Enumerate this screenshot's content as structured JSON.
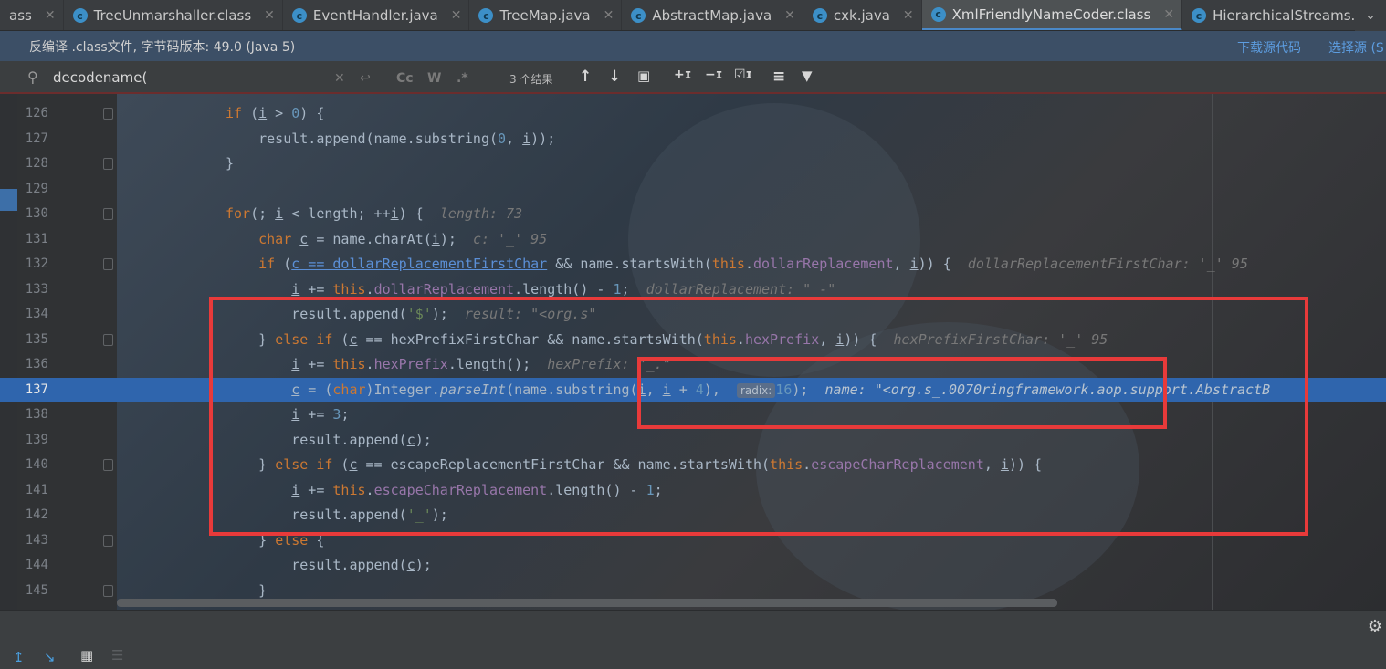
{
  "tabs": [
    {
      "label": "ass",
      "icon": "",
      "active": false
    },
    {
      "label": "TreeUnmarshaller.class",
      "icon": "class-icon",
      "active": false
    },
    {
      "label": "EventHandler.java",
      "icon": "class-icon",
      "active": false
    },
    {
      "label": "TreeMap.java",
      "icon": "class-icon",
      "active": false
    },
    {
      "label": "AbstractMap.java",
      "icon": "class-icon",
      "active": false
    },
    {
      "label": "cxk.java",
      "icon": "class-icon",
      "active": false
    },
    {
      "label": "XmlFriendlyNameCoder.class",
      "icon": "class-icon",
      "active": true
    },
    {
      "label": "HierarchicalStreams.class",
      "icon": "class-icon",
      "active": false
    }
  ],
  "tab_icon_glyph": "c",
  "tab_close": "✕",
  "tab_more": "⌄",
  "infobar": {
    "text": "反编译 .class文件, 字节码版本: 49.0 (Java 5)",
    "download_link": "下载源代码",
    "choose_link": "选择源 (S"
  },
  "find": {
    "query": "decodename(",
    "clear": "✕",
    "replace_icon": "↩",
    "case_label": "Cc",
    "words_label": "W",
    "regex_label": ".*",
    "result_count": "3 个结果",
    "up": "↑",
    "down": "↓",
    "select_all": "▣",
    "add_occ": "+ɪ",
    "remove_occ": "−ɪ",
    "select_occ": "☑ɪ",
    "options": "≡",
    "filter": "▼"
  },
  "code_lines": [
    {
      "num": "126"
    },
    {
      "num": "127"
    },
    {
      "num": "128"
    },
    {
      "num": "129"
    },
    {
      "num": "130"
    },
    {
      "num": "131"
    },
    {
      "num": "132"
    },
    {
      "num": "133"
    },
    {
      "num": "134"
    },
    {
      "num": "135"
    },
    {
      "num": "136"
    },
    {
      "num": "137"
    },
    {
      "num": "138"
    },
    {
      "num": "139"
    },
    {
      "num": "140"
    },
    {
      "num": "141"
    },
    {
      "num": "142"
    },
    {
      "num": "143"
    },
    {
      "num": "144"
    },
    {
      "num": "145"
    }
  ],
  "inlay": {
    "length": "length: 73",
    "c": "c: '_' 95",
    "dollar_first": "dollarReplacementFirstChar: '_' 95",
    "dollar_repl": "dollarReplacement: \"_-\"",
    "result": "result: \"<org.s\"",
    "hex_first": "hexPrefixFirstChar: '_' 95",
    "hex_prefix": "hexPrefix: \"_.\"",
    "radix": "radix:",
    "name": "name: \"<org.s_.0070ringframework.aop.support.AbstractB"
  },
  "highlight_color": "#2f65ad",
  "annotation_color": "#e83a3a",
  "bottom": {
    "icons": [
      "upload-icon",
      "step-icon",
      "calculator-icon",
      "layout-icon"
    ],
    "gear": "⚙"
  }
}
